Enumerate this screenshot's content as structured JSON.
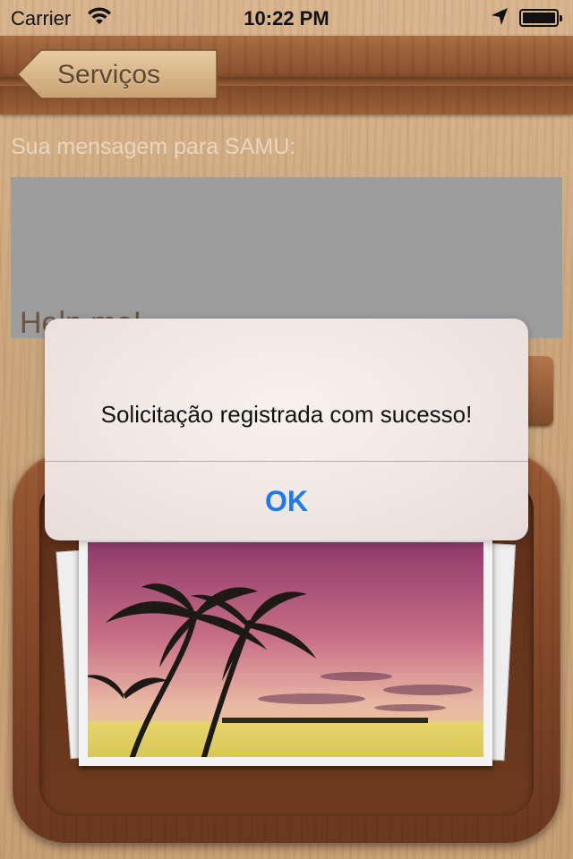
{
  "status_bar": {
    "carrier": "Carrier",
    "time": "10:22 PM",
    "wifi_icon": "wifi-icon",
    "location_icon": "location-arrow-icon",
    "battery_icon": "battery-full-icon"
  },
  "nav": {
    "back_label": "Serviços"
  },
  "form": {
    "prompt": "Sua mensagem para SAMU:",
    "message_value": "Help me!"
  },
  "alert": {
    "message": "Solicitação registrada com sucesso!",
    "ok_label": "OK"
  },
  "colors": {
    "accent": "#1a7bf2",
    "wood": "#c9a47c",
    "nav_wood": "#8b5331",
    "message_box": "#9d9d9d"
  }
}
